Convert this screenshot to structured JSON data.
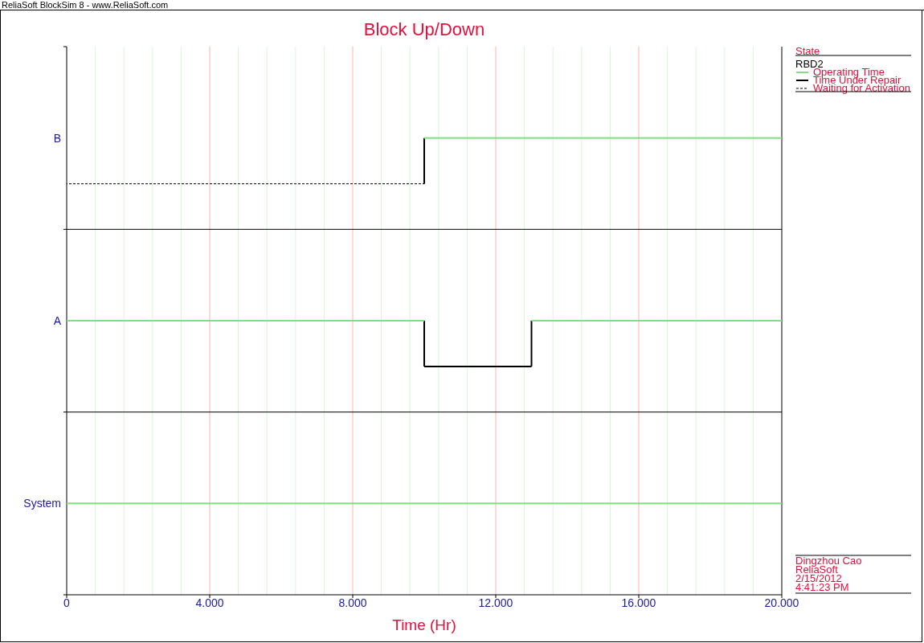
{
  "window": {
    "title": "ReliaSoft BlockSim 8 - www.ReliaSoft.com"
  },
  "chart_data": {
    "type": "bar",
    "orientation": "horizontal",
    "stacked": true,
    "title": "Block Up/Down",
    "xlabel": "Time (Hr)",
    "xlim": [
      0,
      20000
    ],
    "xticks": [
      {
        "value": 0,
        "label": "0"
      },
      {
        "value": 4000,
        "label": "4.000"
      },
      {
        "value": 8000,
        "label": "8.000"
      },
      {
        "value": 12000,
        "label": "12.000"
      },
      {
        "value": 16000,
        "label": "16.000"
      },
      {
        "value": 20000,
        "label": "20.000"
      }
    ],
    "categories": [
      "B",
      "A",
      "System"
    ],
    "grid": true,
    "legend": true,
    "series": [
      {
        "name": "Waiting for Activation",
        "color": "#000000",
        "values": [
          10000,
          null,
          null
        ]
      },
      {
        "name": "Operating Time",
        "color": "#7ee07e",
        "values": [
          10000,
          10000,
          20000
        ]
      },
      {
        "name": "Time Under Repair",
        "color": "#000000",
        "values": [
          null,
          3000,
          null
        ]
      },
      {
        "color": "#7ee07e",
        "values": [
          null,
          7000,
          null
        ]
      }
    ]
  },
  "legend": {
    "heading": "State",
    "name": "RBD2"
  },
  "footer": [
    "Dingzhou Cao",
    "ReliaSoft",
    "2/15/2012",
    "4:41:23 PM"
  ]
}
